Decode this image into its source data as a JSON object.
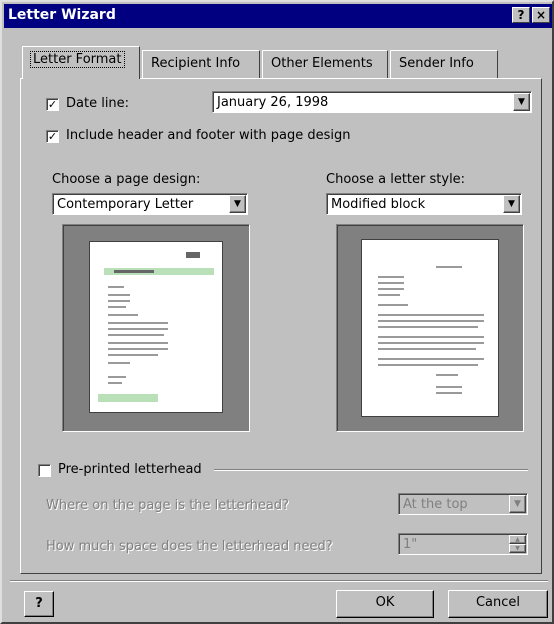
{
  "window": {
    "title": "Letter Wizard",
    "help_btn": "?",
    "close_btn": "×"
  },
  "tabs": [
    {
      "label": "Letter Format",
      "active": true
    },
    {
      "label": "Recipient Info",
      "active": false
    },
    {
      "label": "Other Elements",
      "active": false
    },
    {
      "label": "Sender Info",
      "active": false
    }
  ],
  "date_line": {
    "checked": true,
    "label": "Date line:",
    "value": "January 26, 1998"
  },
  "header_footer": {
    "checked": true,
    "label": "Include header and footer with page design"
  },
  "page_design": {
    "label": "Choose a page design:",
    "value": "Contemporary Letter"
  },
  "letter_style": {
    "label": "Choose a letter style:",
    "value": "Modified block"
  },
  "letterhead": {
    "checked": false,
    "label": "Pre-printed letterhead",
    "where_label": "Where on the page is the letterhead?",
    "where_value": "At the top",
    "space_label": "How much space does the letterhead need?",
    "space_value": "1\""
  },
  "footer": {
    "help_icon": "?",
    "ok_label": "OK",
    "cancel_label": "Cancel"
  },
  "colors": {
    "title_bar": "#000080",
    "face": "#c0c0c0",
    "preview_accent": "#b9e0b9"
  }
}
